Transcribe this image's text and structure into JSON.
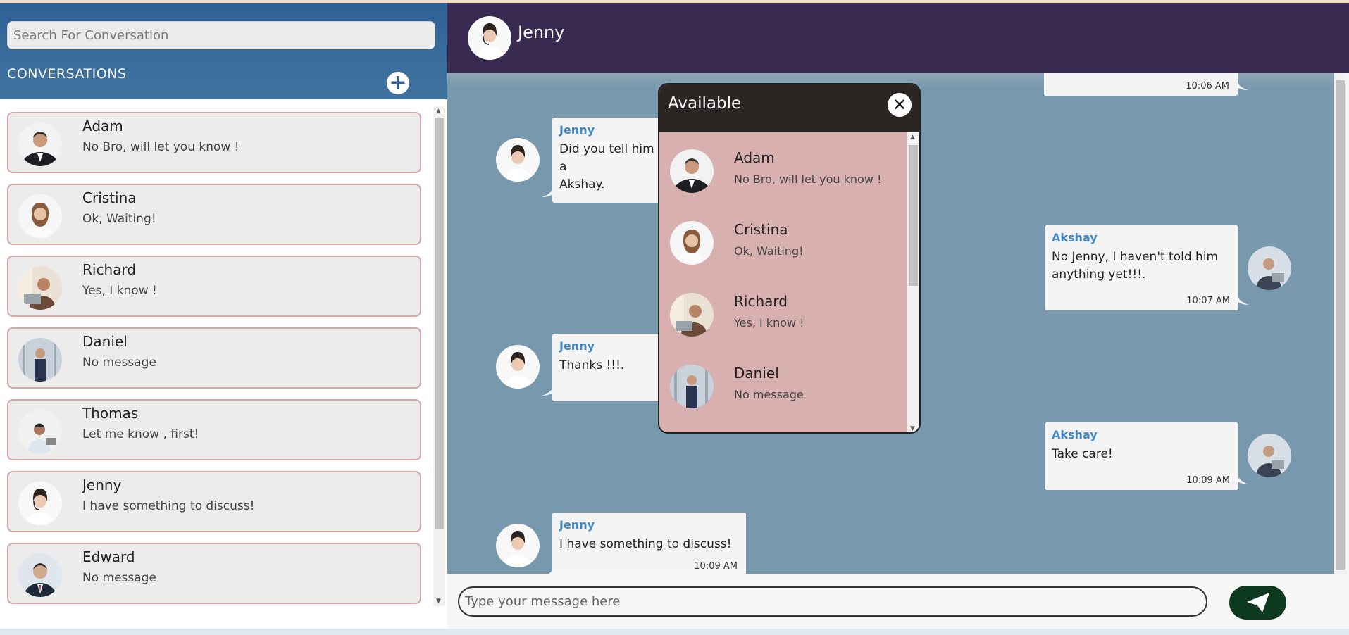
{
  "sidebar": {
    "search_placeholder": "Search For Conversation",
    "conversations_label": "CONVERSATIONS",
    "add_label": "+",
    "items": [
      {
        "name": "Adam",
        "preview": "No Bro, will let you know !"
      },
      {
        "name": "Cristina",
        "preview": "Ok, Waiting!"
      },
      {
        "name": "Richard",
        "preview": "Yes, I know !"
      },
      {
        "name": "Daniel",
        "preview": "No message"
      },
      {
        "name": "Thomas",
        "preview": "Let me know , first!"
      },
      {
        "name": "Jenny",
        "preview": "I have something to discuss!"
      },
      {
        "name": "Edward",
        "preview": "No message"
      }
    ]
  },
  "chat": {
    "name": "Jenny",
    "messages": [
      {
        "sender": "",
        "text": "",
        "time": "10:06 AM"
      },
      {
        "sender": "Jenny",
        "text": "Did you tell him a",
        "text2": "Akshay.",
        "time": ""
      },
      {
        "sender": "Akshay",
        "text": "No Jenny, I haven't told him anything yet!!!.",
        "time": "10:07 AM"
      },
      {
        "sender": "Jenny",
        "text": "Thanks !!!.",
        "time": ""
      },
      {
        "sender": "Akshay",
        "text": "Take care!",
        "time": "10:09 AM"
      },
      {
        "sender": "Jenny",
        "text": "I have something to discuss!",
        "time": "10:09 AM"
      }
    ],
    "composer_placeholder": "Type your message here",
    "send_icon": "paper-plane-icon"
  },
  "popup": {
    "title": "Available",
    "close_label": "✕",
    "items": [
      {
        "name": "Adam",
        "preview": "No Bro, will let you know !"
      },
      {
        "name": "Cristina",
        "preview": "Ok, Waiting!"
      },
      {
        "name": "Richard",
        "preview": "Yes, I know !"
      },
      {
        "name": "Daniel",
        "preview": "No message"
      }
    ]
  },
  "colors": {
    "sidebar_header": "#3b6d9c",
    "chat_header": "#392a51",
    "chat_background": "#7898ad",
    "popup_background": "#d8b0b0",
    "sender_name": "#3f88c5",
    "send_button": "#0d3a1f"
  }
}
